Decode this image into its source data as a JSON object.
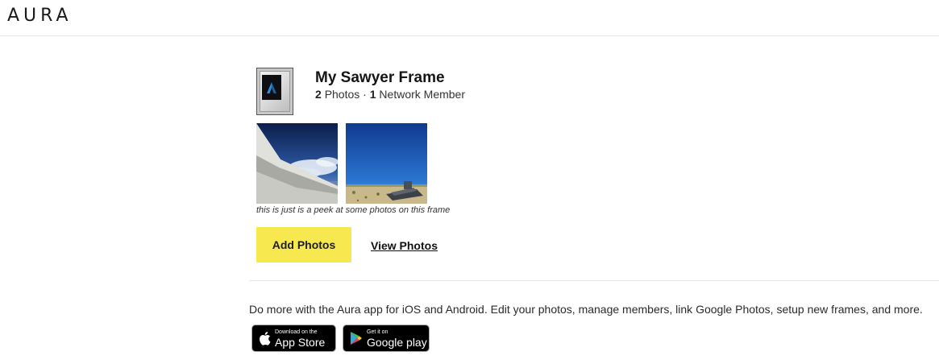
{
  "header": {
    "logo": "AURA"
  },
  "frame": {
    "thumbnail_icon": "aura-logo-icon",
    "title": "My Sawyer Frame",
    "photo_count": "2",
    "photo_label": "Photos",
    "separator": "·",
    "member_count": "1",
    "member_label": "Network Member"
  },
  "preview": {
    "caption": "this is just is a peek at some photos on this frame"
  },
  "actions": {
    "add_photos": "Add Photos",
    "view_photos": "View Photos"
  },
  "promo": {
    "text": "Do more with the Aura app for iOS and Android. Edit your photos, manage members, link Google Photos, setup new frames, and more."
  },
  "stores": {
    "app_store": {
      "small": "Download on the",
      "big": "App Store",
      "icon": "apple-icon"
    },
    "google_play": {
      "small": "Get it on",
      "big": "Google play",
      "icon": "google-play-icon"
    }
  },
  "colors": {
    "accent": "#f7e84f",
    "divider": "#e4e4e4"
  }
}
